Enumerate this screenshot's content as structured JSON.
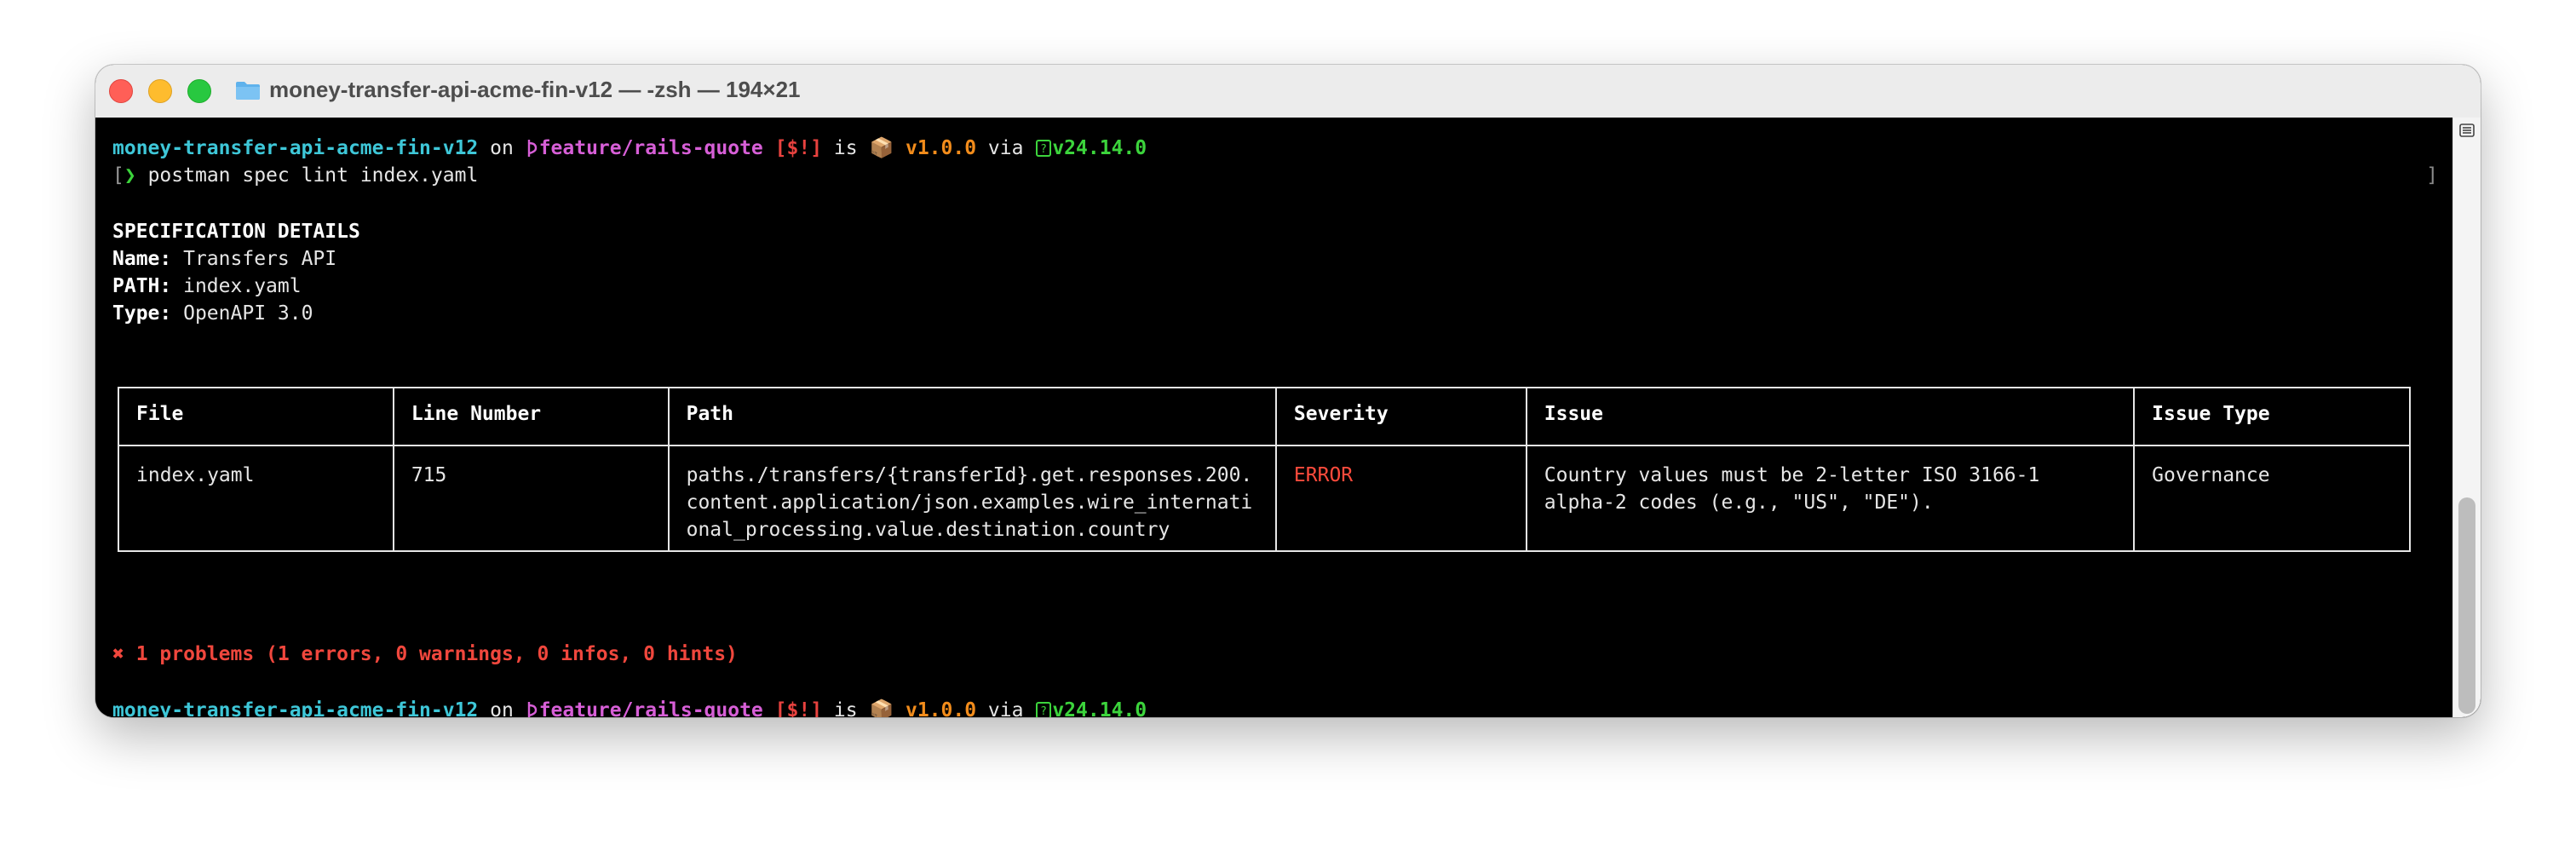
{
  "window": {
    "title": "money-transfer-api-acme-fin-v12 — -zsh — 194×21"
  },
  "prompt": {
    "dir": "money-transfer-api-acme-fin-v12",
    "on": "on",
    "branch_icon": "",
    "branch": "feature/rails-quote",
    "status": "[$!]",
    "is": "is",
    "package_icon": "📦",
    "package_version": "v1.0.0",
    "via": "via",
    "node_icon": "⬢",
    "node_version": "v24.14.0",
    "chevron": "❯"
  },
  "command": {
    "bracket_left": "[",
    "text": "postman spec lint index.yaml",
    "bracket_right": "]"
  },
  "spec": {
    "heading": "SPECIFICATION DETAILS",
    "name_label": "Name:",
    "name_value": "Transfers API",
    "path_label": "PATH:",
    "path_value": "index.yaml",
    "type_label": "Type:",
    "type_value": "OpenAPI 3.0"
  },
  "table": {
    "headers": [
      "File",
      "Line Number",
      "Path",
      "Severity",
      "Issue",
      "Issue Type"
    ],
    "rows": [
      {
        "file": "index.yaml",
        "line": "715",
        "path": "paths./transfers/{transferId}.get.responses.200.content.application/json.examples.wire_international_processing.value.destination.country",
        "severity": "ERROR",
        "issue": "Country values must be 2-letter ISO 3166-1 alpha-2 codes (e.g., \"US\", \"DE\").",
        "issue_type": "Governance"
      }
    ]
  },
  "summary": "✖ 1 problems (1 errors, 0 warnings, 0 infos, 0 hints)",
  "colors": {
    "cyan": "#3ec7d8",
    "magenta": "#d75fd7",
    "red": "#e8423f",
    "orange": "#f28c1b",
    "green": "#3cd43c"
  }
}
